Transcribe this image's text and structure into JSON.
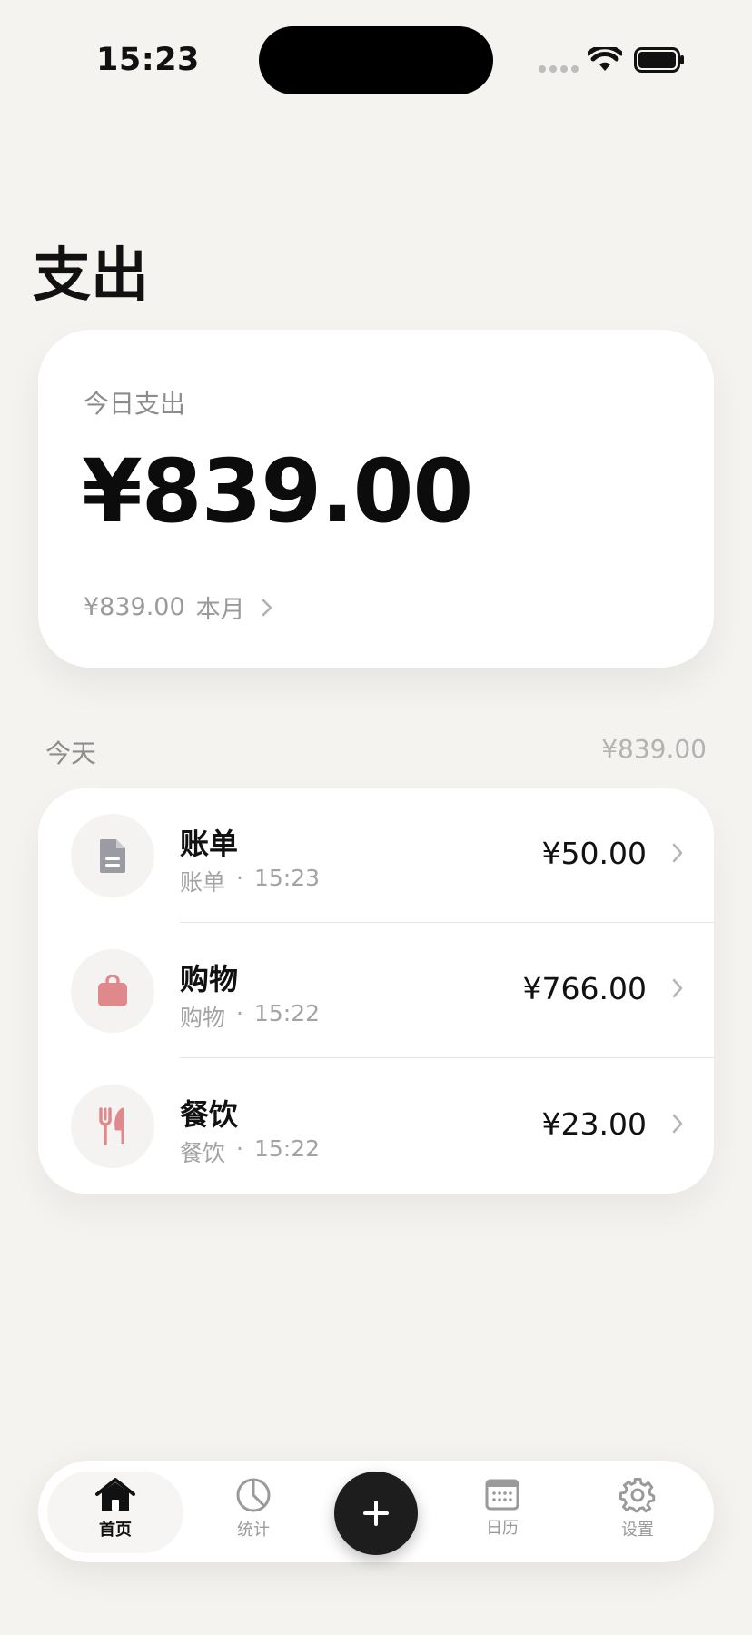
{
  "status_bar": {
    "time": "15:23"
  },
  "page": {
    "title": "支出"
  },
  "summary": {
    "label": "今日支出",
    "amount": "¥839.00",
    "month_amount": "¥839.00",
    "month_unit": "本月"
  },
  "section": {
    "title": "今天",
    "total": "¥839.00"
  },
  "transactions": [
    {
      "title": "账单",
      "category": "账单",
      "time": "15:23",
      "amount": "¥50.00",
      "icon": "document-icon",
      "icon_color": "#9b9ba3"
    },
    {
      "title": "购物",
      "category": "购物",
      "time": "15:22",
      "amount": "¥766.00",
      "icon": "shopping-bag-icon",
      "icon_color": "#e0898c"
    },
    {
      "title": "餐饮",
      "category": "餐饮",
      "time": "15:22",
      "amount": "¥23.00",
      "icon": "fork-knife-icon",
      "icon_color": "#e0898c"
    }
  ],
  "separator": "·",
  "tab_bar": {
    "tabs": [
      {
        "label": "首页",
        "icon": "home-icon",
        "active": true
      },
      {
        "label": "统计",
        "icon": "pie-chart-icon",
        "active": false
      },
      {
        "label": "日历",
        "icon": "calendar-icon",
        "active": false
      },
      {
        "label": "设置",
        "icon": "gear-icon",
        "active": false
      }
    ],
    "add_icon": "plus-icon"
  },
  "colors": {
    "background": "#f4f3f0",
    "card": "#ffffff",
    "accent": "#1d1d1d"
  }
}
